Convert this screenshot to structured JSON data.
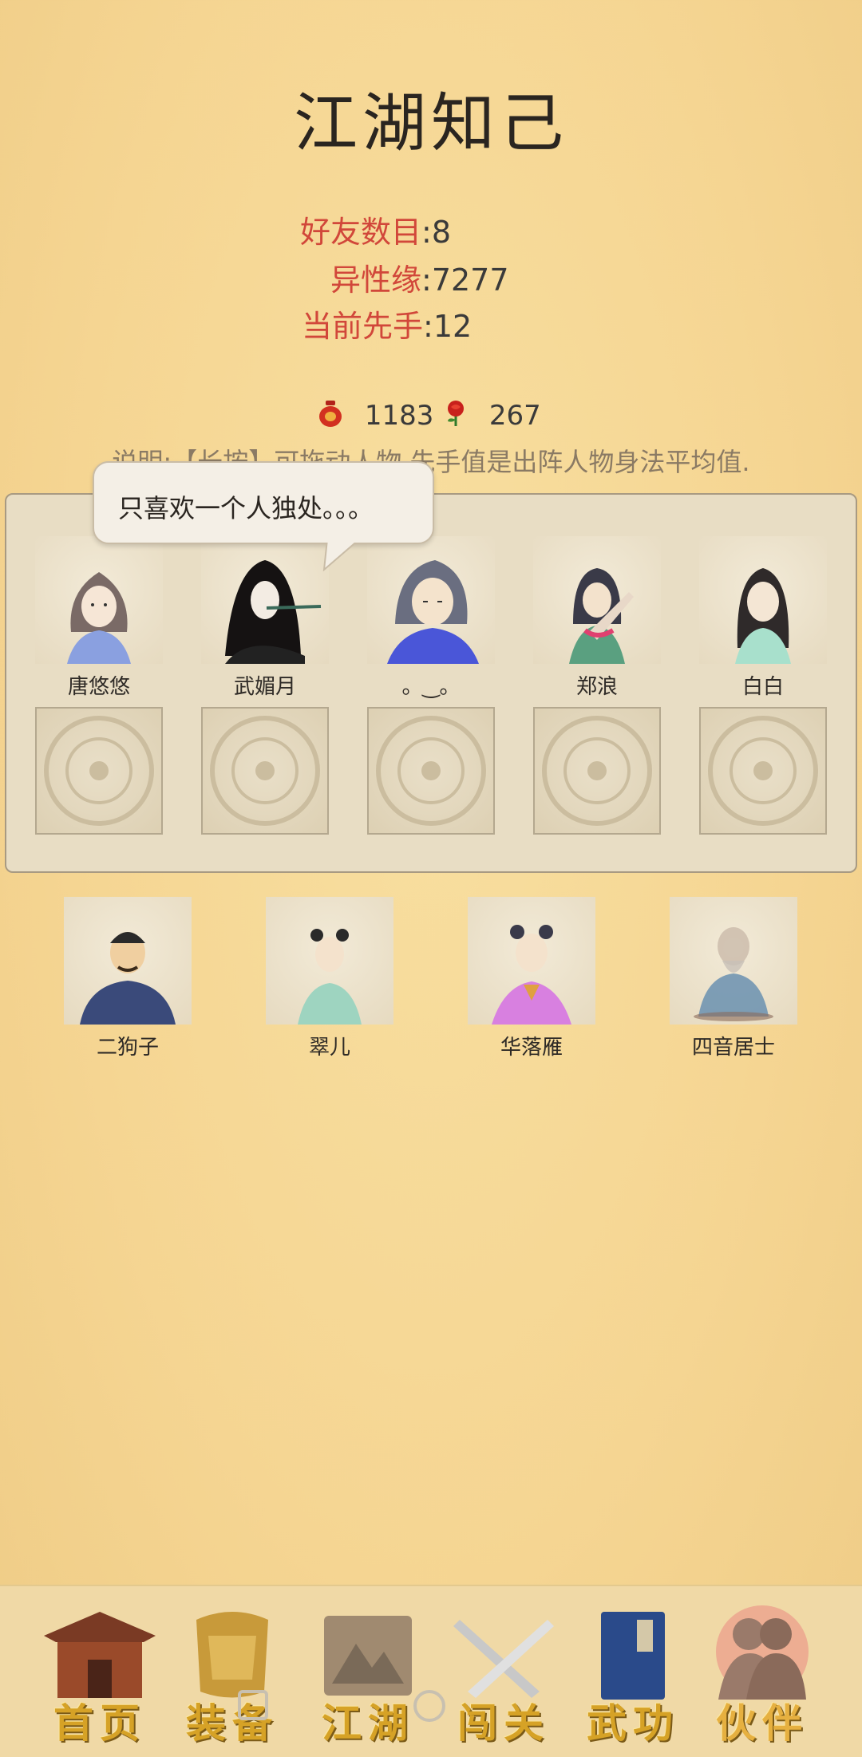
{
  "header": {
    "title": "江湖知己"
  },
  "stats": [
    {
      "label": "好友数目",
      "value": "8"
    },
    {
      "label": "异性缘",
      "value": "7277"
    },
    {
      "label": "当前先手",
      "value": "12"
    }
  ],
  "currency": {
    "jar": {
      "value": "1183",
      "icon": "wine-jar-icon"
    },
    "rose": {
      "value": "267",
      "icon": "rose-icon"
    }
  },
  "note": "说明:【长按】可拖动人物.先手值是出阵人物身法平均值.",
  "speech_bubble": "只喜欢一个人独处。。。",
  "party_slots": [
    {
      "name": "唐悠悠"
    },
    {
      "name": "武媚月"
    },
    {
      "name": "。‿。"
    },
    {
      "name": "郑浪"
    },
    {
      "name": "白白"
    }
  ],
  "reserve": [
    {
      "name": "二狗子"
    },
    {
      "name": "翠儿"
    },
    {
      "name": "华落雁"
    },
    {
      "name": "四音居士"
    }
  ],
  "tabs": [
    {
      "label": "首页",
      "icon": "house-icon"
    },
    {
      "label": "装备",
      "icon": "armor-icon"
    },
    {
      "label": "江湖",
      "icon": "map-scroll-icon"
    },
    {
      "label": "闯关",
      "icon": "crossed-swords-icon"
    },
    {
      "label": "武功",
      "icon": "martial-book-icon"
    },
    {
      "label": "伙伴",
      "icon": "companions-icon",
      "active": true
    }
  ],
  "colors": {
    "accent_label": "#d1473a",
    "background": "#f5d592",
    "tab_gold": "#d6a226"
  }
}
